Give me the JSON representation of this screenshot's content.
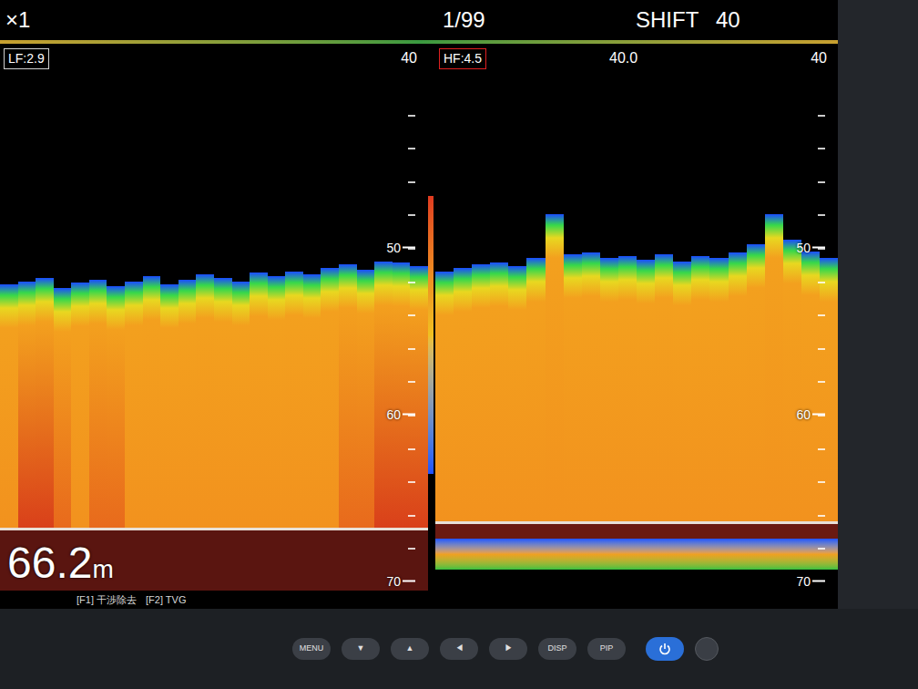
{
  "header": {
    "zoom": "×1",
    "page": "1/99",
    "shift_label": "SHIFT",
    "shift_value": "40"
  },
  "panels": [
    {
      "freq_label": "LF:2.9",
      "selected": false,
      "labels": [
        "40"
      ],
      "ticks": [
        "50",
        "60",
        "70"
      ],
      "echo_top": [
        52.2,
        52.0,
        51.8,
        52.4,
        52.1,
        51.9,
        52.3,
        52.0,
        51.7,
        52.2,
        51.9,
        51.6,
        51.8,
        52.0,
        51.5,
        51.7,
        51.4,
        51.6,
        51.2,
        51.0,
        51.3,
        50.8,
        50.9,
        51.1
      ],
      "echo_strength": [
        0.5,
        0.8,
        0.85,
        0.7,
        0.4,
        0.6,
        0.7,
        0.5,
        0.4,
        0.5,
        0.4,
        0.3,
        0.5,
        0.4,
        0.3,
        0.4,
        0.5,
        0.4,
        0.5,
        0.6,
        0.7,
        0.9,
        0.85,
        0.8
      ],
      "bottom_depth": 66.8,
      "second_echo": false
    },
    {
      "freq_label": "HF:4.5",
      "selected": true,
      "labels": [
        "40.0",
        "40"
      ],
      "ticks": [
        "50",
        "60",
        "70"
      ],
      "echo_top": [
        51.4,
        51.2,
        51.0,
        50.9,
        51.1,
        50.6,
        48.0,
        50.4,
        50.3,
        50.6,
        50.5,
        50.7,
        50.4,
        50.8,
        50.5,
        50.6,
        50.3,
        49.8,
        48.0,
        49.5,
        50.2,
        50.6
      ],
      "echo_strength": [
        0.4,
        0.45,
        0.5,
        0.4,
        0.45,
        0.5,
        0.4,
        0.5,
        0.45,
        0.4,
        0.5,
        0.45,
        0.4,
        0.5,
        0.45,
        0.4,
        0.5,
        0.45,
        0.4,
        0.45,
        0.5,
        0.45
      ],
      "bottom_depth": 66.4,
      "second_echo": true
    }
  ],
  "depth_readout": {
    "value": "66.2",
    "unit": "m"
  },
  "function_keys": [
    "[F1] 干渉除去",
    "[F2] TVG"
  ],
  "bezel_buttons": [
    {
      "kind": "key",
      "label": "MENU"
    },
    {
      "kind": "key",
      "label": "▼"
    },
    {
      "kind": "key",
      "label": "▲"
    },
    {
      "kind": "key",
      "label": "◀"
    },
    {
      "kind": "key",
      "label": "▶"
    },
    {
      "kind": "key",
      "label": "DISP"
    },
    {
      "kind": "key",
      "label": "PIP"
    },
    {
      "kind": "power"
    },
    {
      "kind": "round"
    }
  ]
}
